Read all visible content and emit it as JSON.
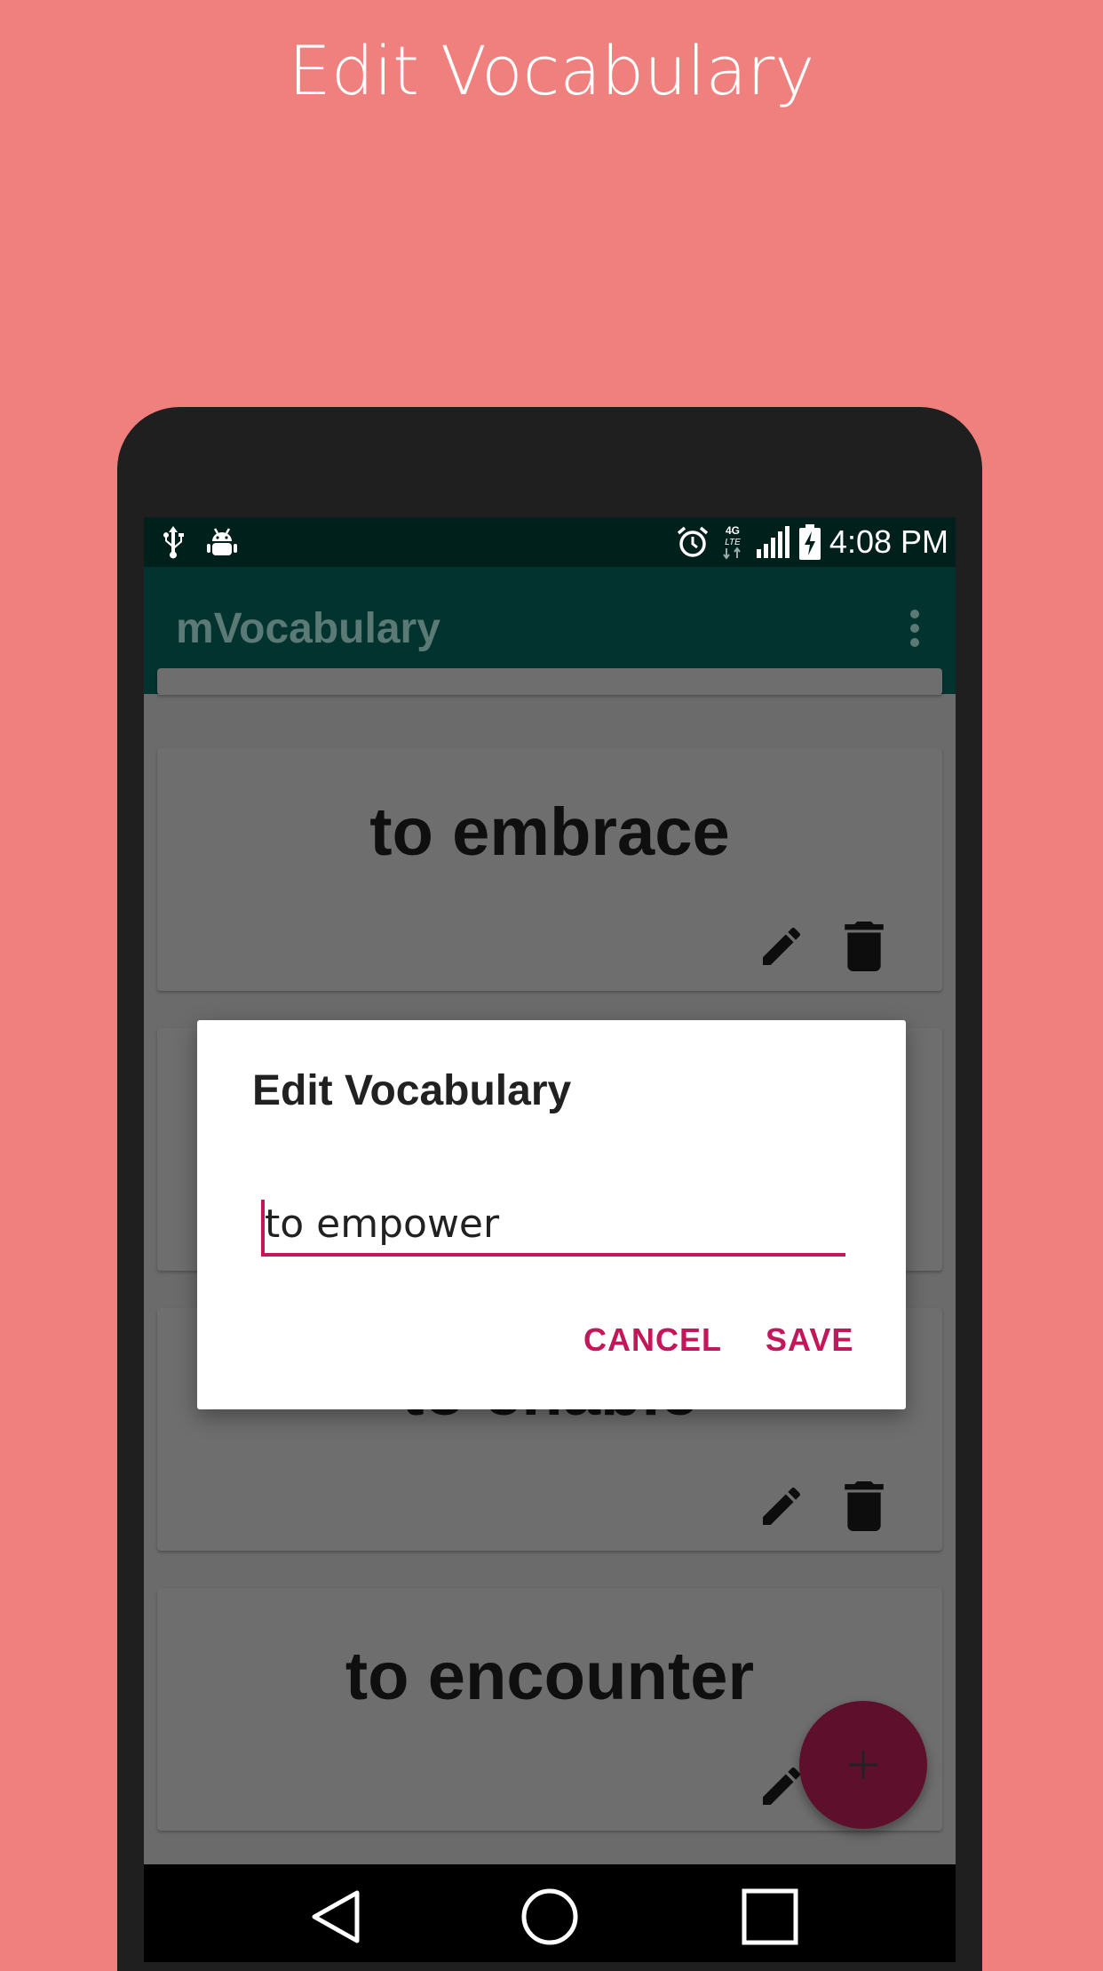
{
  "promo": {
    "title": "Edit Vocabulary"
  },
  "status_bar": {
    "time": "4:08 PM",
    "icons_left": [
      "usb-icon",
      "android-debug-icon"
    ],
    "icons_right": [
      "alarm-icon",
      "4g-lte-icon",
      "signal-icon",
      "battery-charging-icon"
    ]
  },
  "app_bar": {
    "title": "mVocabulary",
    "overflow_icon": "more-vert-icon"
  },
  "cards": [
    {
      "word": "to embrace"
    },
    {
      "word": "to enable"
    },
    {
      "word": "to encounter"
    }
  ],
  "dialog": {
    "title": "Edit Vocabulary",
    "input_value": "to empower",
    "cancel_label": "CANCEL",
    "save_label": "SAVE"
  },
  "fab": {
    "icon": "plus-icon"
  },
  "nav_bar": {
    "icons": [
      "back-icon",
      "home-icon",
      "recents-icon"
    ]
  },
  "colors": {
    "background": "#F0807D",
    "app_bar": "#02332F",
    "status_bar": "#00201C",
    "accent": "#C2185B",
    "fab": "#5E0F2C"
  }
}
